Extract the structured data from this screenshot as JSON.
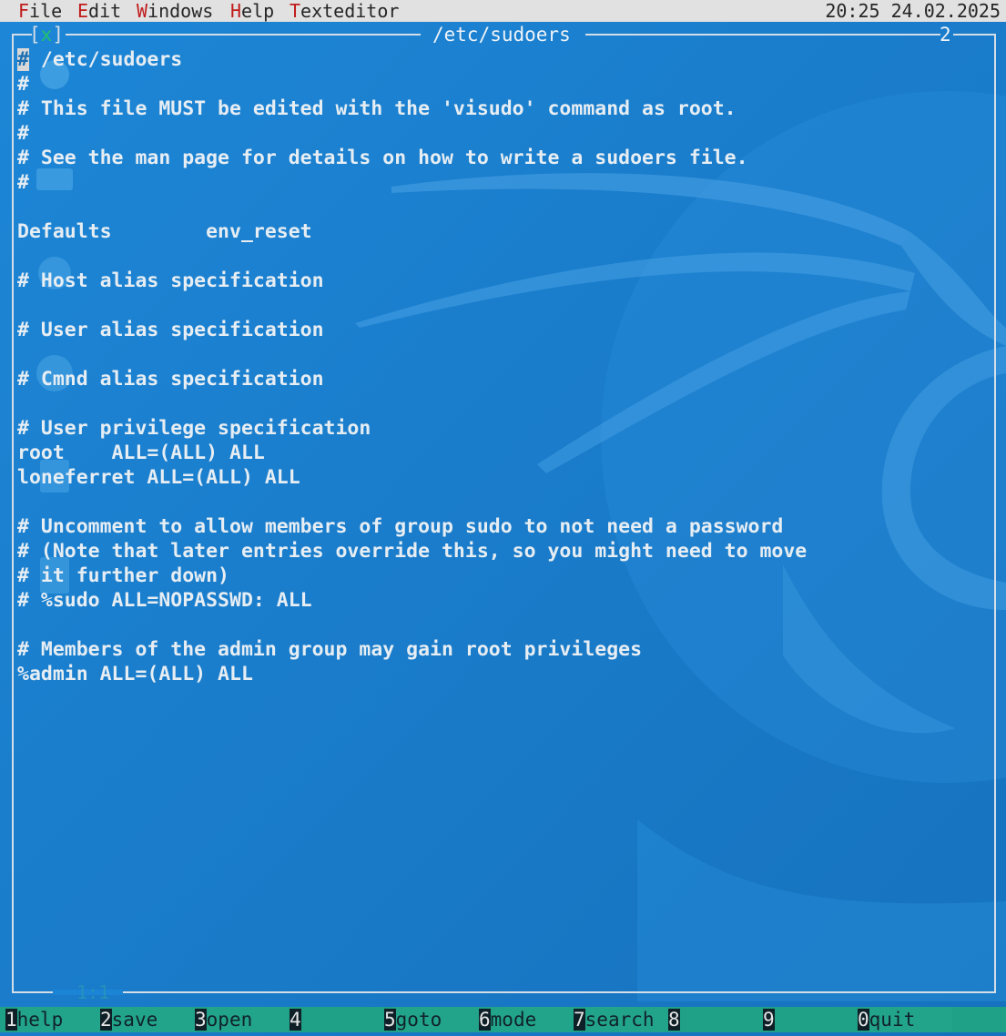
{
  "menubar": {
    "items": [
      {
        "hotkey": "F",
        "rest": "ile"
      },
      {
        "hotkey": "E",
        "rest": "dit"
      },
      {
        "hotkey": "W",
        "rest": "indows"
      },
      {
        "hotkey": "H",
        "rest": "elp"
      },
      {
        "hotkey": "T",
        "rest": "exteditor"
      }
    ],
    "clock": "20:25 24.02.2025"
  },
  "window": {
    "close_label": "[x]",
    "title": "/etc/sudoers",
    "number": "2",
    "cursor_position": "1:1"
  },
  "editor": {
    "lines": [
      "# /etc/sudoers",
      "#",
      "# This file MUST be edited with the 'visudo' command as root.",
      "#",
      "# See the man page for details on how to write a sudoers file.",
      "#",
      "",
      "Defaults        env_reset",
      "",
      "# Host alias specification",
      "",
      "# User alias specification",
      "",
      "# Cmnd alias specification",
      "",
      "# User privilege specification",
      "root    ALL=(ALL) ALL",
      "loneferret ALL=(ALL) ALL",
      "",
      "# Uncomment to allow members of group sudo to not need a password",
      "# (Note that later entries override this, so you might need to move",
      "# it further down)",
      "# %sudo ALL=NOPASSWD: ALL",
      "",
      "# Members of the admin group may gain root privileges",
      "%admin ALL=(ALL) ALL"
    ]
  },
  "fkeys": [
    {
      "num": "1",
      "label": "help"
    },
    {
      "num": "2",
      "label": "save"
    },
    {
      "num": "3",
      "label": "open"
    },
    {
      "num": "4",
      "label": ""
    },
    {
      "num": "5",
      "label": "goto"
    },
    {
      "num": "6",
      "label": "mode"
    },
    {
      "num": "7",
      "label": "search"
    },
    {
      "num": "8",
      "label": ""
    },
    {
      "num": "9",
      "label": ""
    },
    {
      "num": "0",
      "label": "quit"
    }
  ],
  "colors": {
    "background": "#1b84d4",
    "menu_bg": "#e1e1e1",
    "hotkey": "#c01b1b",
    "fkey_bar": "#22a48a"
  }
}
